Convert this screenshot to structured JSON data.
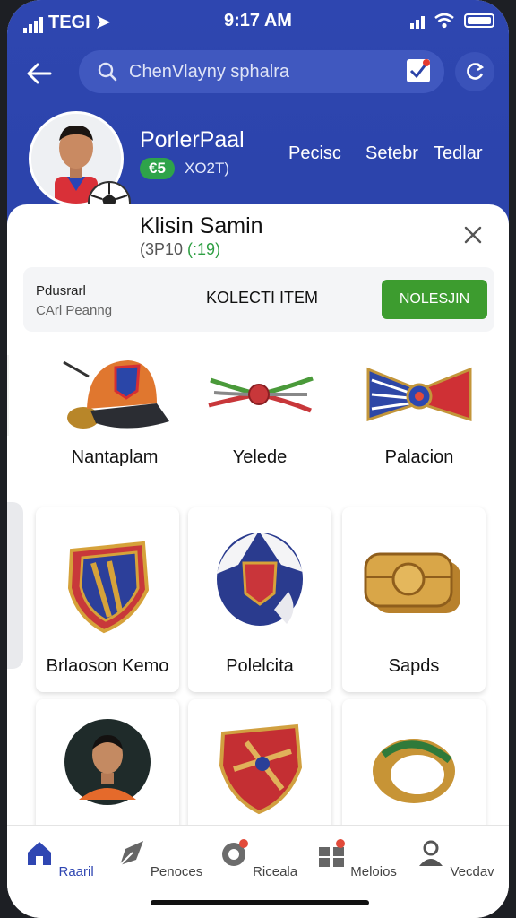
{
  "status": {
    "carrier": "TEGI",
    "time": "9:17 AM"
  },
  "search": {
    "placeholder": "ChenVlayny sphalra"
  },
  "profile": {
    "name": "PorlerPaal",
    "badge": "€5",
    "score": "XO2T)",
    "links": [
      "Pecisc",
      "Setebr",
      "Tedlar"
    ]
  },
  "sheet": {
    "title": "Klisin Samin",
    "subtitle_prefix": "(3P10 ",
    "subtitle_green": "(:19)",
    "bar": {
      "line1": "Pdusrarl",
      "line2": "CArl Peanng",
      "center": "KOLECTI ITEM",
      "button": "NOLESJIN"
    }
  },
  "items": [
    {
      "label": "Nantaplam",
      "icon": "cap-icon"
    },
    {
      "label": "Yelede",
      "icon": "rope-knot-icon"
    },
    {
      "label": "Palacion",
      "icon": "bowtie-icon"
    }
  ],
  "cards": [
    {
      "label": "Brlaoson Kemo",
      "icon": "crest-shield-icon"
    },
    {
      "label": "Polelcita",
      "icon": "football-helmet-icon"
    },
    {
      "label": "Sapds",
      "icon": "gold-ingot-icon"
    },
    {
      "label": "",
      "icon": "player-portrait-icon"
    },
    {
      "label": "",
      "icon": "badge-sword-icon"
    },
    {
      "label": "",
      "icon": "gold-ring-icon"
    }
  ],
  "nav": [
    {
      "label": "Raaril",
      "icon": "home-icon",
      "active": true
    },
    {
      "label": "Penoces",
      "icon": "kite-icon",
      "active": false
    },
    {
      "label": "Riceala",
      "icon": "rewards-icon",
      "active": false
    },
    {
      "label": "Meloios",
      "icon": "grid-icon",
      "active": false
    },
    {
      "label": "Vecdav",
      "icon": "user-icon",
      "active": false
    }
  ],
  "colors": {
    "header": "#2d45ad",
    "accent_green": "#3d9c2f",
    "nav_active": "#2f46b2"
  }
}
